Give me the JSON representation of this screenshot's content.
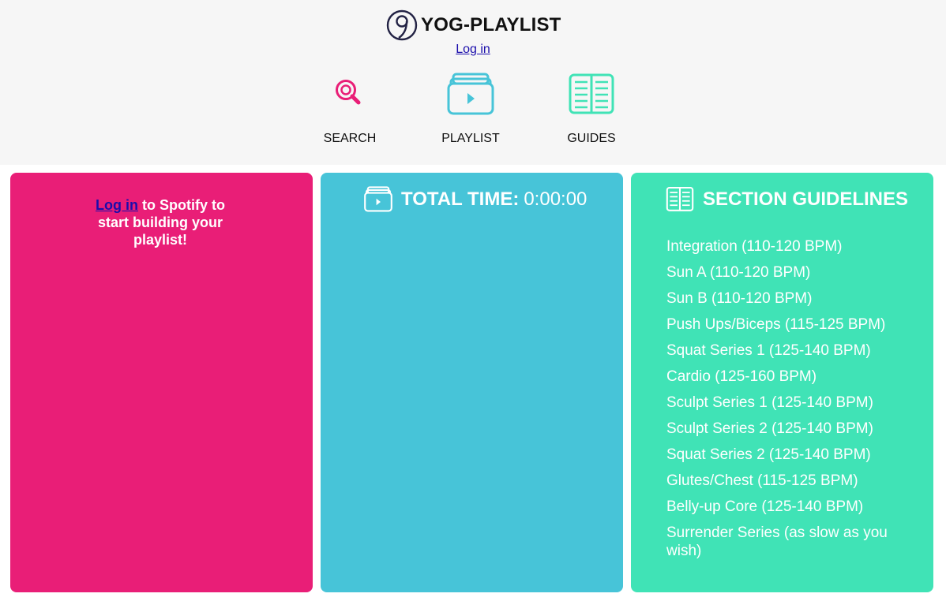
{
  "brand": {
    "title": "YOG-PLAYLIST",
    "logo_icon": "yog-logo-icon"
  },
  "header": {
    "login_label": "Log in"
  },
  "nav": {
    "search_label": "SEARCH",
    "playlist_label": "PLAYLIST",
    "guides_label": "GUIDES"
  },
  "colors": {
    "pink": "#e91e77",
    "blue": "#47c4d8",
    "green": "#40e3b6",
    "header_bg": "#f6f6f6"
  },
  "search_panel": {
    "login_link": "Log in",
    "message": " to Spotify to start building your playlist!"
  },
  "playlist_panel": {
    "total_label": "TOTAL TIME:",
    "total_value": "0:00:00"
  },
  "guides_panel": {
    "title": "SECTION GUIDELINES",
    "items": [
      "Integration (110-120 BPM)",
      "Sun A (110-120 BPM)",
      "Sun B (110-120 BPM)",
      "Push Ups/Biceps (115-125 BPM)",
      "Squat Series 1 (125-140 BPM)",
      "Cardio (125-160 BPM)",
      "Sculpt Series 1 (125-140 BPM)",
      "Sculpt Series 2 (125-140 BPM)",
      "Squat Series 2 (125-140 BPM)",
      "Glutes/Chest (115-125 BPM)",
      "Belly-up Core (125-140 BPM)",
      "Surrender Series (as slow as you wish)"
    ]
  }
}
